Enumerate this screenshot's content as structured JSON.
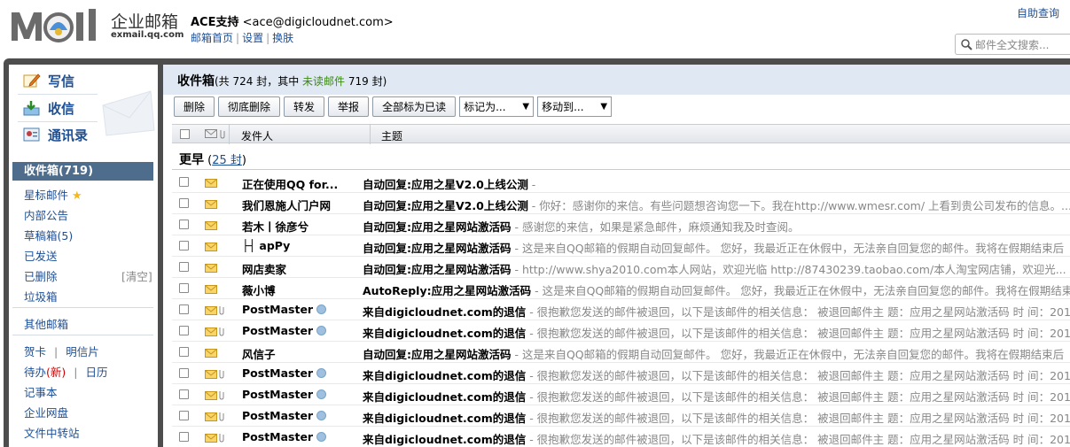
{
  "brand": {
    "logo_text": "MOil",
    "name_cn": "企业邮箱",
    "domain": "exmail.qq.com"
  },
  "account": {
    "name": "ACE支持",
    "email": "<ace@digicloudnet.com>",
    "links": [
      "邮箱首页",
      "设置",
      "换肤"
    ],
    "separator": "|"
  },
  "help": "自助查询",
  "search": {
    "placeholder": "邮件全文搜索..."
  },
  "sidebar": {
    "top": [
      {
        "label": "写信",
        "icon": "compose-icon"
      },
      {
        "label": "收信",
        "icon": "receive-icon"
      },
      {
        "label": "通讯录",
        "icon": "contacts-icon"
      }
    ],
    "inbox": "收件箱(719)",
    "star": "星标邮件",
    "folders": [
      "内部公告",
      "草稿箱(5)",
      "已发送",
      "已删除",
      "垃圾箱"
    ],
    "clear": "[清空]",
    "other": "其他邮箱",
    "cards": {
      "a": "贺卡",
      "sep": "|",
      "b": "明信片"
    },
    "todo": {
      "a": "待办",
      "new": "(新)",
      "sep": "|",
      "b": "日历"
    },
    "notes": "记事本",
    "disk": "企业网盘",
    "transfer": "文件中转站"
  },
  "main": {
    "title": "收件箱",
    "summary_a": "(共 724 封，其中 ",
    "unread": "未读邮件",
    "summary_b": " 719 封)",
    "toolbar": {
      "delete": "删除",
      "purge": "彻底删除",
      "forward": "转发",
      "report": "举报",
      "mark_all": "全部标为已读",
      "mark_as": "标记为...",
      "move_to": "移动到..."
    },
    "columns": {
      "from": "发件人",
      "subject": "主题"
    },
    "group": {
      "label": "更早",
      "count": "25 封"
    },
    "rows": [
      {
        "from": "正在使用QQ for...",
        "subject": "自动回复:应用之星V2.0上线公测",
        "preview": " - ",
        "attach": false,
        "qq": false
      },
      {
        "from": "我们恩施人门户网",
        "subject": "自动回复:应用之星V2.0上线公测",
        "preview": " - 你好：感谢你的来信。有些问题想咨询您一下。我在http://www.wmesr.com/ 上看到贵公司发布的信息。...",
        "attach": false,
        "qq": false
      },
      {
        "from": "若木丨徐彦兮",
        "subject": "自动回复:应用之星网站激活码",
        "preview": " - 感谢您的来信，如果是紧急邮件，麻烦通知我及时查阅。",
        "attach": false,
        "qq": false
      },
      {
        "from": "├┤ apPy",
        "subject": "自动回复:应用之星网站激活码",
        "preview": " - 这是来自QQ邮箱的假期自动回复邮件。  您好，我最近正在休假中，无法亲自回复您的邮件。我将在假期结束后",
        "attach": false,
        "qq": false
      },
      {
        "from": "网店卖家",
        "subject": "自动回复:应用之星网站激活码",
        "preview": " - http://www.shya2010.com本人网站，欢迎光临 http://87430239.taobao.com/本人淘宝网店铺，欢迎光...",
        "attach": false,
        "qq": false
      },
      {
        "from": "薇小博",
        "subject": "AutoReply:应用之星网站激活码",
        "preview": " - 这是来自QQ邮箱的假期自动回复邮件。  您好，我最近正在休假中，无法亲自回复您的邮件。我将在假期结束",
        "attach": false,
        "qq": false
      },
      {
        "from": "PostMaster",
        "subject": "来自digicloudnet.com的退信",
        "preview": " - 很抱歉您发送的邮件被退回，以下是该邮件的相关信息：  被退回邮件主 题：应用之星网站激活码  时 间：201",
        "attach": true,
        "qq": true
      },
      {
        "from": "PostMaster",
        "subject": "来自digicloudnet.com的退信",
        "preview": " - 很抱歉您发送的邮件被退回，以下是该邮件的相关信息：  被退回邮件主 题：应用之星网站激活码  时 间：201",
        "attach": true,
        "qq": true
      },
      {
        "from": "风信子",
        "subject": "自动回复:应用之星网站激活码",
        "preview": " - 这是来自QQ邮箱的假期自动回复邮件。  您好，我最近正在休假中，无法亲自回复您的邮件。我将在假期结束后",
        "attach": false,
        "qq": false
      },
      {
        "from": "PostMaster",
        "subject": "来自digicloudnet.com的退信",
        "preview": " - 很抱歉您发送的邮件被退回，以下是该邮件的相关信息：  被退回邮件主 题：应用之星网站激活码  时 间：201",
        "attach": true,
        "qq": true
      },
      {
        "from": "PostMaster",
        "subject": "来自digicloudnet.com的退信",
        "preview": " - 很抱歉您发送的邮件被退回，以下是该邮件的相关信息：  被退回邮件主 题：应用之星网站激活码  时 间：201",
        "attach": true,
        "qq": true
      },
      {
        "from": "PostMaster",
        "subject": "来自digicloudnet.com的退信",
        "preview": " - 很抱歉您发送的邮件被退回，以下是该邮件的相关信息：  被退回邮件主 题：应用之星网站激活码  时 间：201",
        "attach": true,
        "qq": true
      },
      {
        "from": "PostMaster",
        "subject": "来自digicloudnet.com的退信",
        "preview": " - 很抱歉您发送的邮件被退回，以下是该邮件的相关信息：  被退回邮件主 题：应用之星网站激活码  时 间：201",
        "attach": true,
        "qq": true
      }
    ]
  },
  "colors": {
    "accent": "#1d4f95",
    "inbox_bg": "#4e6c8b",
    "unread": "#3a8a10",
    "frame": "#4d4d4d",
    "envelope": "#e8b830"
  }
}
